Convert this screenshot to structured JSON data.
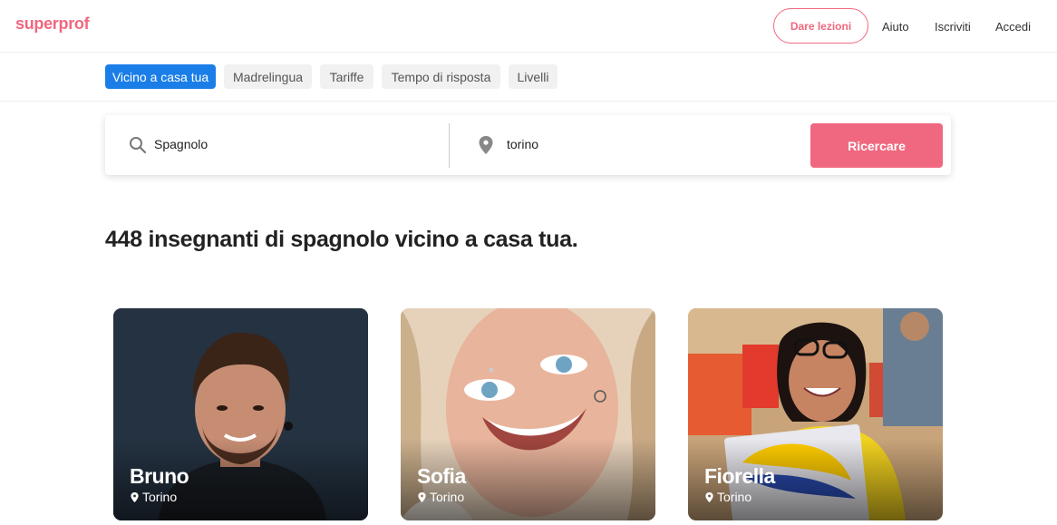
{
  "header": {
    "logo": "superprof",
    "teach_button": "Dare lezioni",
    "links": [
      "Aiuto",
      "Iscriviti",
      "Accedi"
    ]
  },
  "filters": [
    {
      "label": "Vicino a casa tua",
      "active": true
    },
    {
      "label": "Madrelingua",
      "active": false
    },
    {
      "label": "Tariffe",
      "active": false
    },
    {
      "label": "Tempo di risposta",
      "active": false
    },
    {
      "label": "Livelli",
      "active": false
    }
  ],
  "search": {
    "subject_value": "Spagnolo",
    "location_value": "torino",
    "button_label": "Ricercare"
  },
  "headline": "448 insegnanti di spagnolo vicino a casa tua.",
  "teachers": [
    {
      "name": "Bruno",
      "city": "Torino"
    },
    {
      "name": "Sofia",
      "city": "Torino"
    },
    {
      "name": "Fiorella",
      "city": "Torino"
    }
  ],
  "colors": {
    "brand": "#f0687f",
    "active_chip": "#1b7ee8"
  }
}
